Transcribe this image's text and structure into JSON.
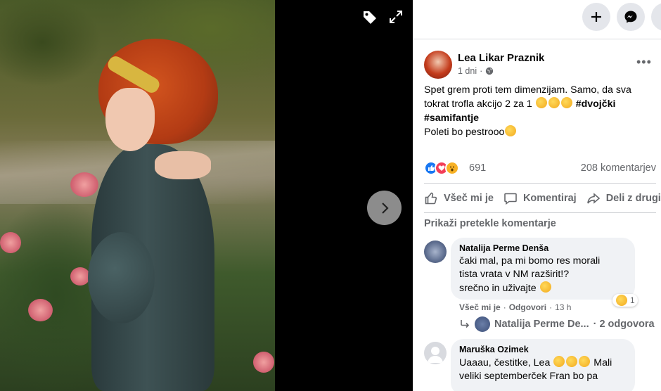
{
  "topbar": {
    "buttons": [
      "plus-icon",
      "messenger-icon",
      "account-icon"
    ]
  },
  "viewer": {
    "icons": [
      "tag-icon",
      "expand-icon",
      "chevron-right-icon"
    ]
  },
  "post": {
    "author": "Lea Likar Praznik",
    "time": "1 dni",
    "visibility_icon": "globe-icon",
    "more": "•••",
    "text_line1": "Spet grem proti tem dimenzijam. Samo, da sva tokrat trofla akcijo 2 za 1",
    "hashtag1": "#dvojčki",
    "hashtag2": "#samifantje",
    "text_line3": "Poleti bo pestrooo",
    "reaction_count": "691",
    "comment_count": "208 komentarjev"
  },
  "actions": {
    "like": "Všeč mi je",
    "comment": "Komentiraj",
    "share": "Deli z drugimi"
  },
  "comments_header": "Prikaži pretekle komentarje",
  "comments": [
    {
      "author": "Natalija Perme Denša",
      "line1": "čaki mal, pa mi bomo res morali",
      "line2": "tista vrata v NM razširit!?",
      "line3": "srečno in uživajte",
      "reaction_count": "1",
      "like": "Všeč mi je",
      "reply": "Odgovori",
      "time": "13 h",
      "replies_author": "Natalija Perme De...",
      "replies_count": "· 2 odgovora"
    },
    {
      "author": "Maruška Ozimek",
      "line1": "Uaaau, čestitke, Lea",
      "line1b": "Mali",
      "line2": "veliki septemberček Fran bo pa"
    }
  ]
}
